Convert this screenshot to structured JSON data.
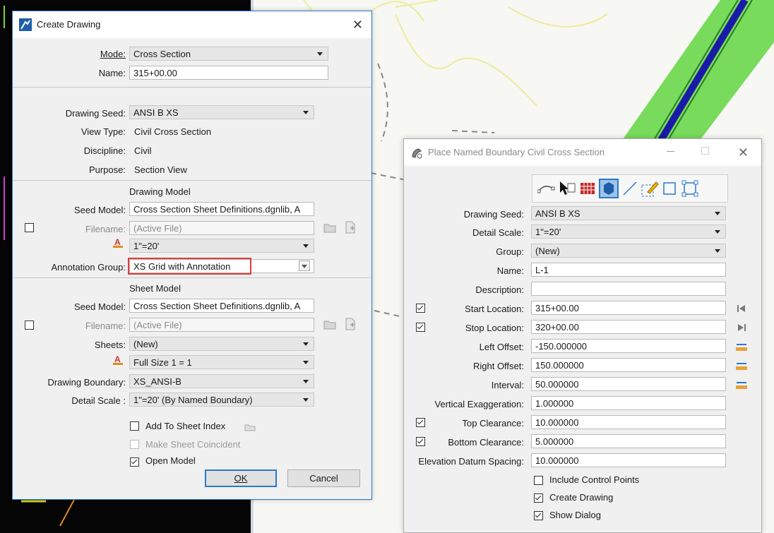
{
  "create_drawing": {
    "title": "Create Drawing",
    "close_glyph": "✕",
    "mode_label": "Mode:",
    "mode_value": "Cross Section",
    "name_label": "Name:",
    "name_value": "315+00.00",
    "drawing_seed_label": "Drawing Seed:",
    "drawing_seed_value": "ANSI B XS",
    "view_type_label": "View Type:",
    "view_type_value": "Civil Cross Section",
    "discipline_label": "Discipline:",
    "discipline_value": "Civil",
    "purpose_label": "Purpose:",
    "purpose_value": "Section View",
    "drawing_model_header": "Drawing Model",
    "dm_seed_model_label": "Seed Model:",
    "dm_seed_model_value": "Cross Section Sheet Definitions.dgnlib, A",
    "dm_filename_label": "Filename:",
    "dm_filename_value": "(Active File)",
    "dm_scale_value": "1\"=20'",
    "annotation_group_label": "Annotation Group:",
    "annotation_group_value": "XS Grid with Annotation",
    "sheet_model_header": "Sheet Model",
    "sm_seed_model_label": "Seed Model:",
    "sm_seed_model_value": "Cross Section Sheet Definitions.dgnlib, A",
    "sm_filename_label": "Filename:",
    "sm_filename_value": "(Active File)",
    "sheets_label": "Sheets:",
    "sheets_value": "(New)",
    "sm_scale_value": "Full Size 1 = 1",
    "drawing_boundary_label": "Drawing Boundary:",
    "drawing_boundary_value": "XS_ANSI-B",
    "detail_scale_label": "Detail Scale :",
    "detail_scale_value": "1\"=20' (By Named Boundary)",
    "add_to_sheet_index": "Add To Sheet Index",
    "make_sheet_coincident": "Make Sheet Coincident",
    "open_model": "Open Model",
    "ok_label": "OK",
    "cancel_label": "Cancel"
  },
  "place_boundary": {
    "title": "Place Named Boundary Civil Cross Section",
    "close_glyph": "✕",
    "drawing_seed_label": "Drawing Seed:",
    "drawing_seed_value": "ANSI B XS",
    "detail_scale_label": "Detail Scale:",
    "detail_scale_value": "1\"=20'",
    "group_label": "Group:",
    "group_value": "(New)",
    "name_label": "Name:",
    "name_value": "L-1",
    "description_label": "Description:",
    "description_value": "",
    "start_location_label": "Start Location:",
    "start_location_value": "315+00.00",
    "stop_location_label": "Stop Location:",
    "stop_location_value": "320+00.00",
    "left_offset_label": "Left Offset:",
    "left_offset_value": "-150.000000",
    "right_offset_label": "Right Offset:",
    "right_offset_value": "150.000000",
    "interval_label": "Interval:",
    "interval_value": "50.000000",
    "vertical_exaggeration_label": "Vertical Exaggeration:",
    "vertical_exaggeration_value": "1.000000",
    "top_clearance_label": "Top Clearance:",
    "top_clearance_value": "10.000000",
    "bottom_clearance_label": "Bottom Clearance:",
    "bottom_clearance_value": "5.000000",
    "elevation_datum_label": "Elevation Datum Spacing:",
    "elevation_datum_value": "10.000000",
    "include_control_points": "Include Control Points",
    "create_drawing": "Create Drawing",
    "show_dialog": "Show Dialog"
  },
  "colors": {
    "accent": "#2b79c9",
    "highlight_box": "#e53935",
    "annotation_icon": "#d32f2f",
    "cad_green": "#63d63f"
  }
}
